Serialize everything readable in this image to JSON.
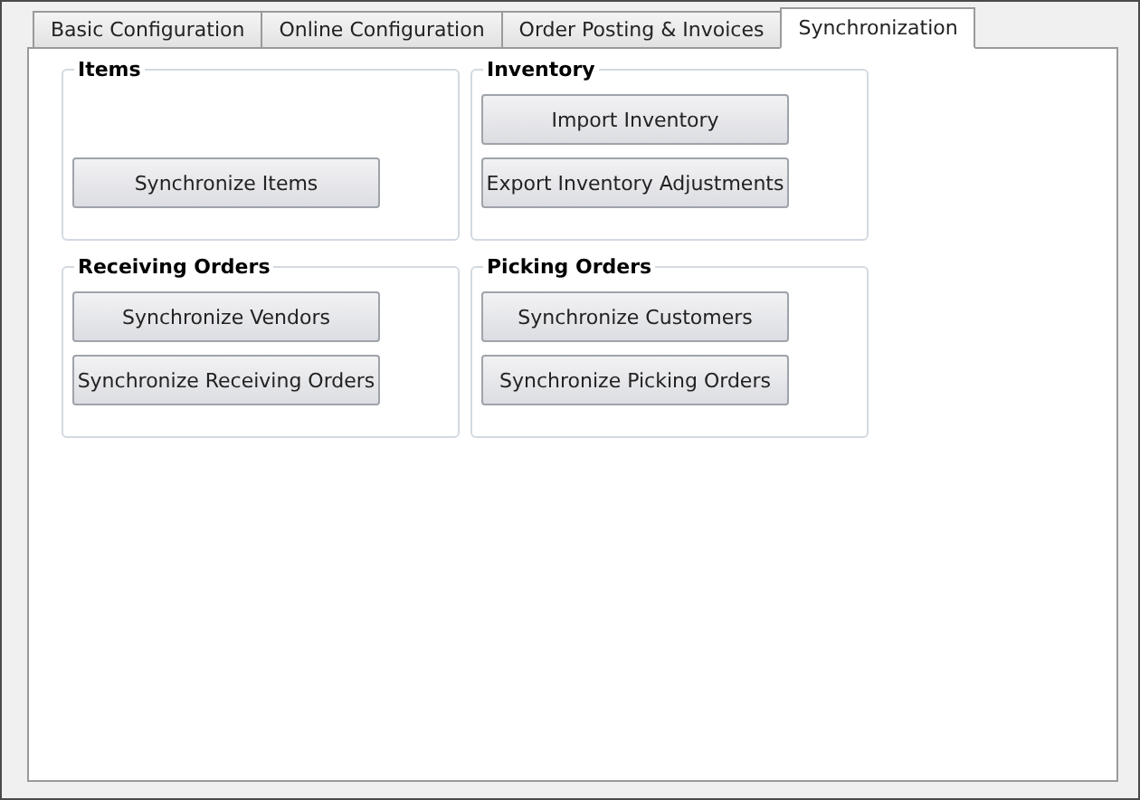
{
  "tabs": [
    {
      "label": "Basic Configuration",
      "selected": false
    },
    {
      "label": "Online Configuration",
      "selected": false
    },
    {
      "label": "Order Posting & Invoices",
      "selected": false
    },
    {
      "label": "Synchronization",
      "selected": true
    }
  ],
  "groups": [
    {
      "title": "Items",
      "buttons": [
        "Synchronize Items"
      ]
    },
    {
      "title": "Inventory",
      "buttons": [
        "Import Inventory",
        "Export Inventory Adjustments"
      ]
    },
    {
      "title": "Receiving Orders",
      "buttons": [
        "Synchronize Vendors",
        "Synchronize Receiving Orders"
      ]
    },
    {
      "title": "Picking Orders",
      "buttons": [
        "Synchronize Customers",
        "Synchronize Picking Orders"
      ]
    }
  ]
}
